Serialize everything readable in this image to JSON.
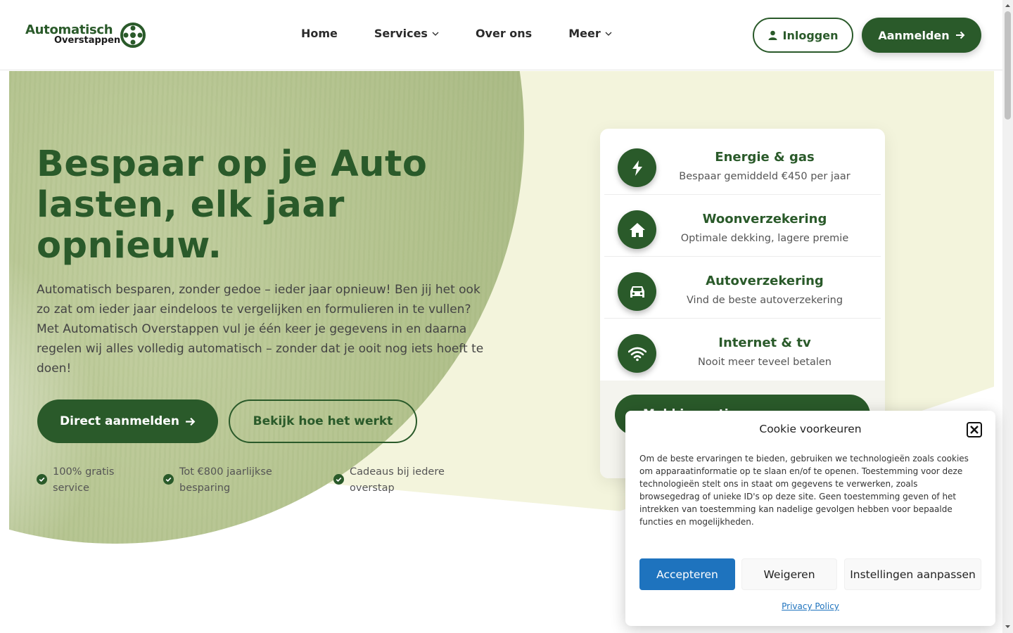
{
  "brand": {
    "line1": "Automatisch",
    "line2": "Overstappen",
    "color": "#2a5a2a"
  },
  "nav": {
    "items": [
      {
        "label": "Home",
        "dropdown": false
      },
      {
        "label": "Services",
        "dropdown": true
      },
      {
        "label": "Over ons",
        "dropdown": false
      },
      {
        "label": "Meer",
        "dropdown": true
      }
    ],
    "login_label": "Inloggen",
    "signup_label": "Aanmelden"
  },
  "hero": {
    "title": "Bespaar op je Auto lasten, elk jaar opnieuw.",
    "text": "Automatisch besparen, zonder gedoe – ieder jaar opnieuw! Ben jij het ook zo zat om ieder jaar eindeloos te vergelijken en formulieren in te vullen? Met Automatisch Overstappen vul je één keer je gegevens in en daarna regelen wij alles volledig automatisch – zonder dat je ooit nog iets hoeft te doen!",
    "primary_button": "Direct aanmelden",
    "secondary_button": "Bekijk hoe het werkt",
    "usps": [
      {
        "line1": "100% gratis",
        "line2": "service"
      },
      {
        "line1": "Tot €800 jaarlijkse",
        "line2": "besparing"
      },
      {
        "line1": "Cadeaus bij iedere",
        "line2": "overstap"
      }
    ]
  },
  "services": [
    {
      "title": "Energie & gas",
      "subtitle": "Bespaar gemiddeld €450 per jaar",
      "icon": "bolt-icon"
    },
    {
      "title": "Woonverzekering",
      "subtitle": "Optimale dekking, lagere premie",
      "icon": "home-icon"
    },
    {
      "title": "Autoverzekering",
      "subtitle": "Vind de beste autoverzekering",
      "icon": "car-icon"
    },
    {
      "title": "Internet & tv",
      "subtitle": "Nooit meer teveel betalen",
      "icon": "wifi-icon"
    }
  ],
  "card_button": "Meld je gratis aan",
  "cookie": {
    "title": "Cookie voorkeuren",
    "text": "Om de beste ervaringen te bieden, gebruiken we technologieën zoals cookies om apparaatinformatie op te slaan en/of te openen. Toestemming voor deze technologieën stelt ons in staat om gegevens te verwerken, zoals browsegedrag of unieke ID's op deze site. Geen toestemming geven of het intrekken van toestemming kan nadelige gevolgen hebben voor bepaalde functies en mogelijkheden.",
    "accept": "Accepteren",
    "deny": "Weigeren",
    "settings": "Instellingen aanpassen",
    "privacy_link": "Privacy Policy",
    "accent": "#1e73be"
  }
}
